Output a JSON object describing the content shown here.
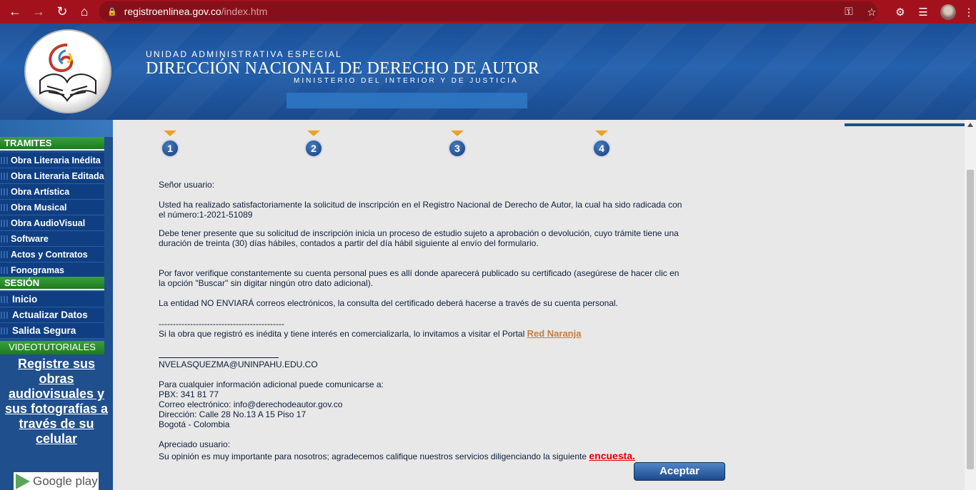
{
  "browser": {
    "url_host": "registroenlinea.gov.co",
    "url_path": "/index.htm",
    "back_icon": "back-arrow-icon",
    "forward_icon": "forward-arrow-icon",
    "reload_icon": "reload-icon",
    "home_icon": "home-icon"
  },
  "header": {
    "subtitle": "UNIDAD ADMINISTRATIVA ESPECIAL",
    "title": "DIRECCIÓN NACIONAL DE DERECHO DE AUTOR",
    "ministry": "MINISTERIO DEL INTERIOR Y DE JUSTICIA"
  },
  "sidebar": {
    "tramites_label": "TRAMITES",
    "tramites": [
      "Obra Literaria Inédita",
      "Obra Literaria Editada",
      "Obra Artística",
      "Obra Musical",
      "Obra AudioVisual",
      "Software",
      "Actos y Contratos",
      "Fonogramas"
    ],
    "sesion_label": "SESIÓN",
    "sesion": [
      "Inicio",
      "Actualizar Datos",
      "Salida Segura"
    ],
    "video_label": "VIDEOTUTORIALES",
    "video_link": [
      "Registre sus",
      "obras",
      "audiovisuales y",
      "sus fotografías a",
      "través de su",
      "celular"
    ],
    "google_play": "Google play"
  },
  "steps": [
    "1",
    "2",
    "3",
    "4"
  ],
  "message": {
    "greeting": "Señor usuario:",
    "p1_line1": "Usted ha realizado satisfactoriamente la solicitud de inscripción en el Registro Nacional de Derecho de Autor, la cual ha sido radicada con",
    "p1_line2": "el número:1-2021-51089",
    "p2_line1": "Debe tener presente que su solicitud de inscripción inicia un proceso de estudio sujeto a aprobación o devolución, cuyo trámite tiene una",
    "p2_line2": "duración de treinta (30) días hábiles, contados a partir del día hábil siguiente al envío del formulario.",
    "p3_line1": "Por favor verifique constantemente su cuenta personal pues es allí donde aparecerá publicado su certificado (asegúrese de hacer clic en",
    "p3_line2": "la opción \"Buscar\" sin digitar ningún otro dato adicional).",
    "p4": "La entidad NO ENVIARÁ correos electrónicos, la consulta del certificado deberá hacerse a través de su cuenta personal.",
    "dashes": "--------------------------------------------",
    "p5": "Si la obra que registró es inédita y tiene interés en comercializarla, lo invitamos a visitar el Portal",
    "red_naranja": "Red Naranja",
    "email": "NVELASQUEZMA@UNINPAHU.EDU.CO",
    "contact_intro": "Para cualquier información adicional puede comunicarse a:",
    "pbx": "PBX: 341 81 77",
    "correo": "Correo electrónico: info@derechodeautor.gov.co",
    "direccion": "Dirección: Calle 28 No.13 A 15 Piso 17",
    "ciudad": "Bogotá - Colombia",
    "apreciado": "Apreciado usuario:",
    "survey": "Su opinión es muy importante para nosotros; agradecemos califique nuestros servicios diligenciando la siguiente",
    "encuesta": "encuesta.",
    "accept": "Aceptar"
  }
}
